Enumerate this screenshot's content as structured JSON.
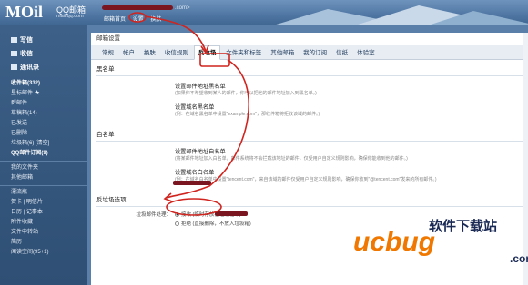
{
  "header": {
    "logo": "MOil",
    "brand": "QQ邮箱",
    "domain": "mail.qq.com",
    "user_suffix": ".com>",
    "links": [
      "邮箱首页",
      "设置",
      "换肤"
    ]
  },
  "sidebar": {
    "main": [
      "写信",
      "收信",
      "通讯录"
    ],
    "folders": [
      {
        "label": "收件箱(332)",
        "style": "bold"
      },
      {
        "label": "星标邮件 ★",
        "style": "normal"
      },
      {
        "label": "群邮件",
        "style": "normal"
      },
      {
        "label": "草稿箱(14)",
        "style": "normal"
      },
      {
        "label": "已发送",
        "style": "normal"
      },
      {
        "label": "已删除",
        "style": "normal"
      },
      {
        "label": "垃圾箱(6)  [清空]",
        "style": "normal"
      },
      {
        "label": "QQ邮件订阅(9)",
        "style": "bold"
      }
    ],
    "more": [
      "我的文件夹",
      "其他邮箱"
    ],
    "apps": [
      "漂流瓶",
      "贺卡 | 明信片",
      "日历 | 记事本",
      "附件收藏",
      "文件中转站",
      "简历",
      "阅读空间(95+1)"
    ]
  },
  "content": {
    "title": "邮箱设置",
    "tabs": [
      "常规",
      "帐户",
      "换肤",
      "收信规则",
      "反垃圾",
      "文件夹和标签",
      "其他邮箱",
      "我的订阅",
      "信纸",
      "体验室"
    ],
    "active_tab": "反垃圾",
    "blacklist": {
      "heading": "黑名单",
      "addr_title": "设置邮件地址黑名单",
      "addr_desc": "(如果你不希望收到某人的邮件，你可以把他的邮件地址加入到黑名单。)",
      "domain_title": "设置域名黑名单",
      "domain_desc": "(例：在域名黑名单中设置\"example.com\"，那收件箱将拒收该域的邮件。)"
    },
    "whitelist": {
      "heading": "白名单",
      "addr_title": "设置邮件地址白名单",
      "addr_desc": "(将某邮件地址加入白名单，邮件系统将不会拦截该地址的邮件，仅受用户自定义规则影响，确保你能收到他的邮件。)",
      "domain_title": "设置域名白名单",
      "domain_desc": "(例：在域名白名单中设置\"tencent.com\"，来自该域的邮件仅受用户自定义规则影响，确保你收到\"@tencent.com\"发来的所有邮件。)"
    },
    "filter": {
      "heading": "反垃圾选项",
      "label": "垃圾邮件处理：",
      "options": [
        "接收 (临时存放在垃圾箱中)",
        "拒绝 (直接删除，不放入垃圾箱)"
      ]
    }
  },
  "watermark": {
    "text": "软件下载站",
    "logo": "ucbug",
    "suffix": ".com"
  },
  "colors": {
    "accent_red": "#d0241f",
    "sidebar": "#2f4f74",
    "watermark_orange": "#f07800"
  }
}
